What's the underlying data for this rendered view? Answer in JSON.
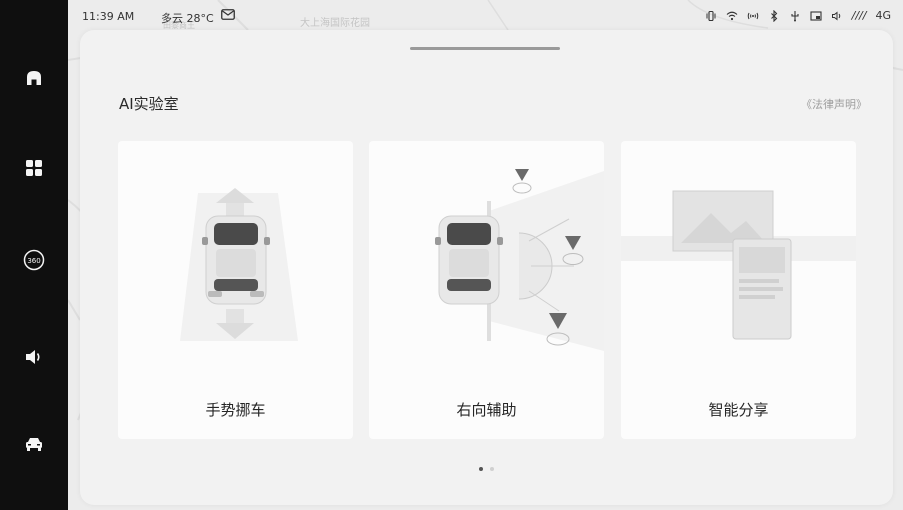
{
  "status_bar": {
    "time": "11:39 AM",
    "weather": "多云 28°C",
    "network": "4G",
    "signal_text": "////",
    "icons": [
      "vibrate-icon",
      "wifi-icon",
      "hotspot-icon",
      "bluetooth-icon",
      "usb-icon",
      "screen-cast-icon",
      "volume-icon"
    ]
  },
  "map": {
    "labels": [
      "大上海国际花园",
      "田黎商王"
    ]
  },
  "dock": {
    "items": [
      {
        "icon": "home-icon"
      },
      {
        "icon": "apps-grid-icon"
      },
      {
        "icon": "camera-360-icon",
        "text": "360"
      },
      {
        "icon": "volume-icon"
      },
      {
        "icon": "car-icon"
      }
    ]
  },
  "panel": {
    "title": "AI实验室",
    "legal_link": "《法律声明》",
    "cards": [
      {
        "label": "手势挪车"
      },
      {
        "label": "右向辅助"
      },
      {
        "label": "智能分享"
      }
    ],
    "pagination": {
      "count": 2,
      "active": 0
    }
  },
  "colors": {
    "dock_bg": "#0f0f0f",
    "panel_bg": "#f2f2f2",
    "card_bg": "#fcfcfc",
    "text_primary": "#262626",
    "text_muted": "#9d9d9d"
  }
}
